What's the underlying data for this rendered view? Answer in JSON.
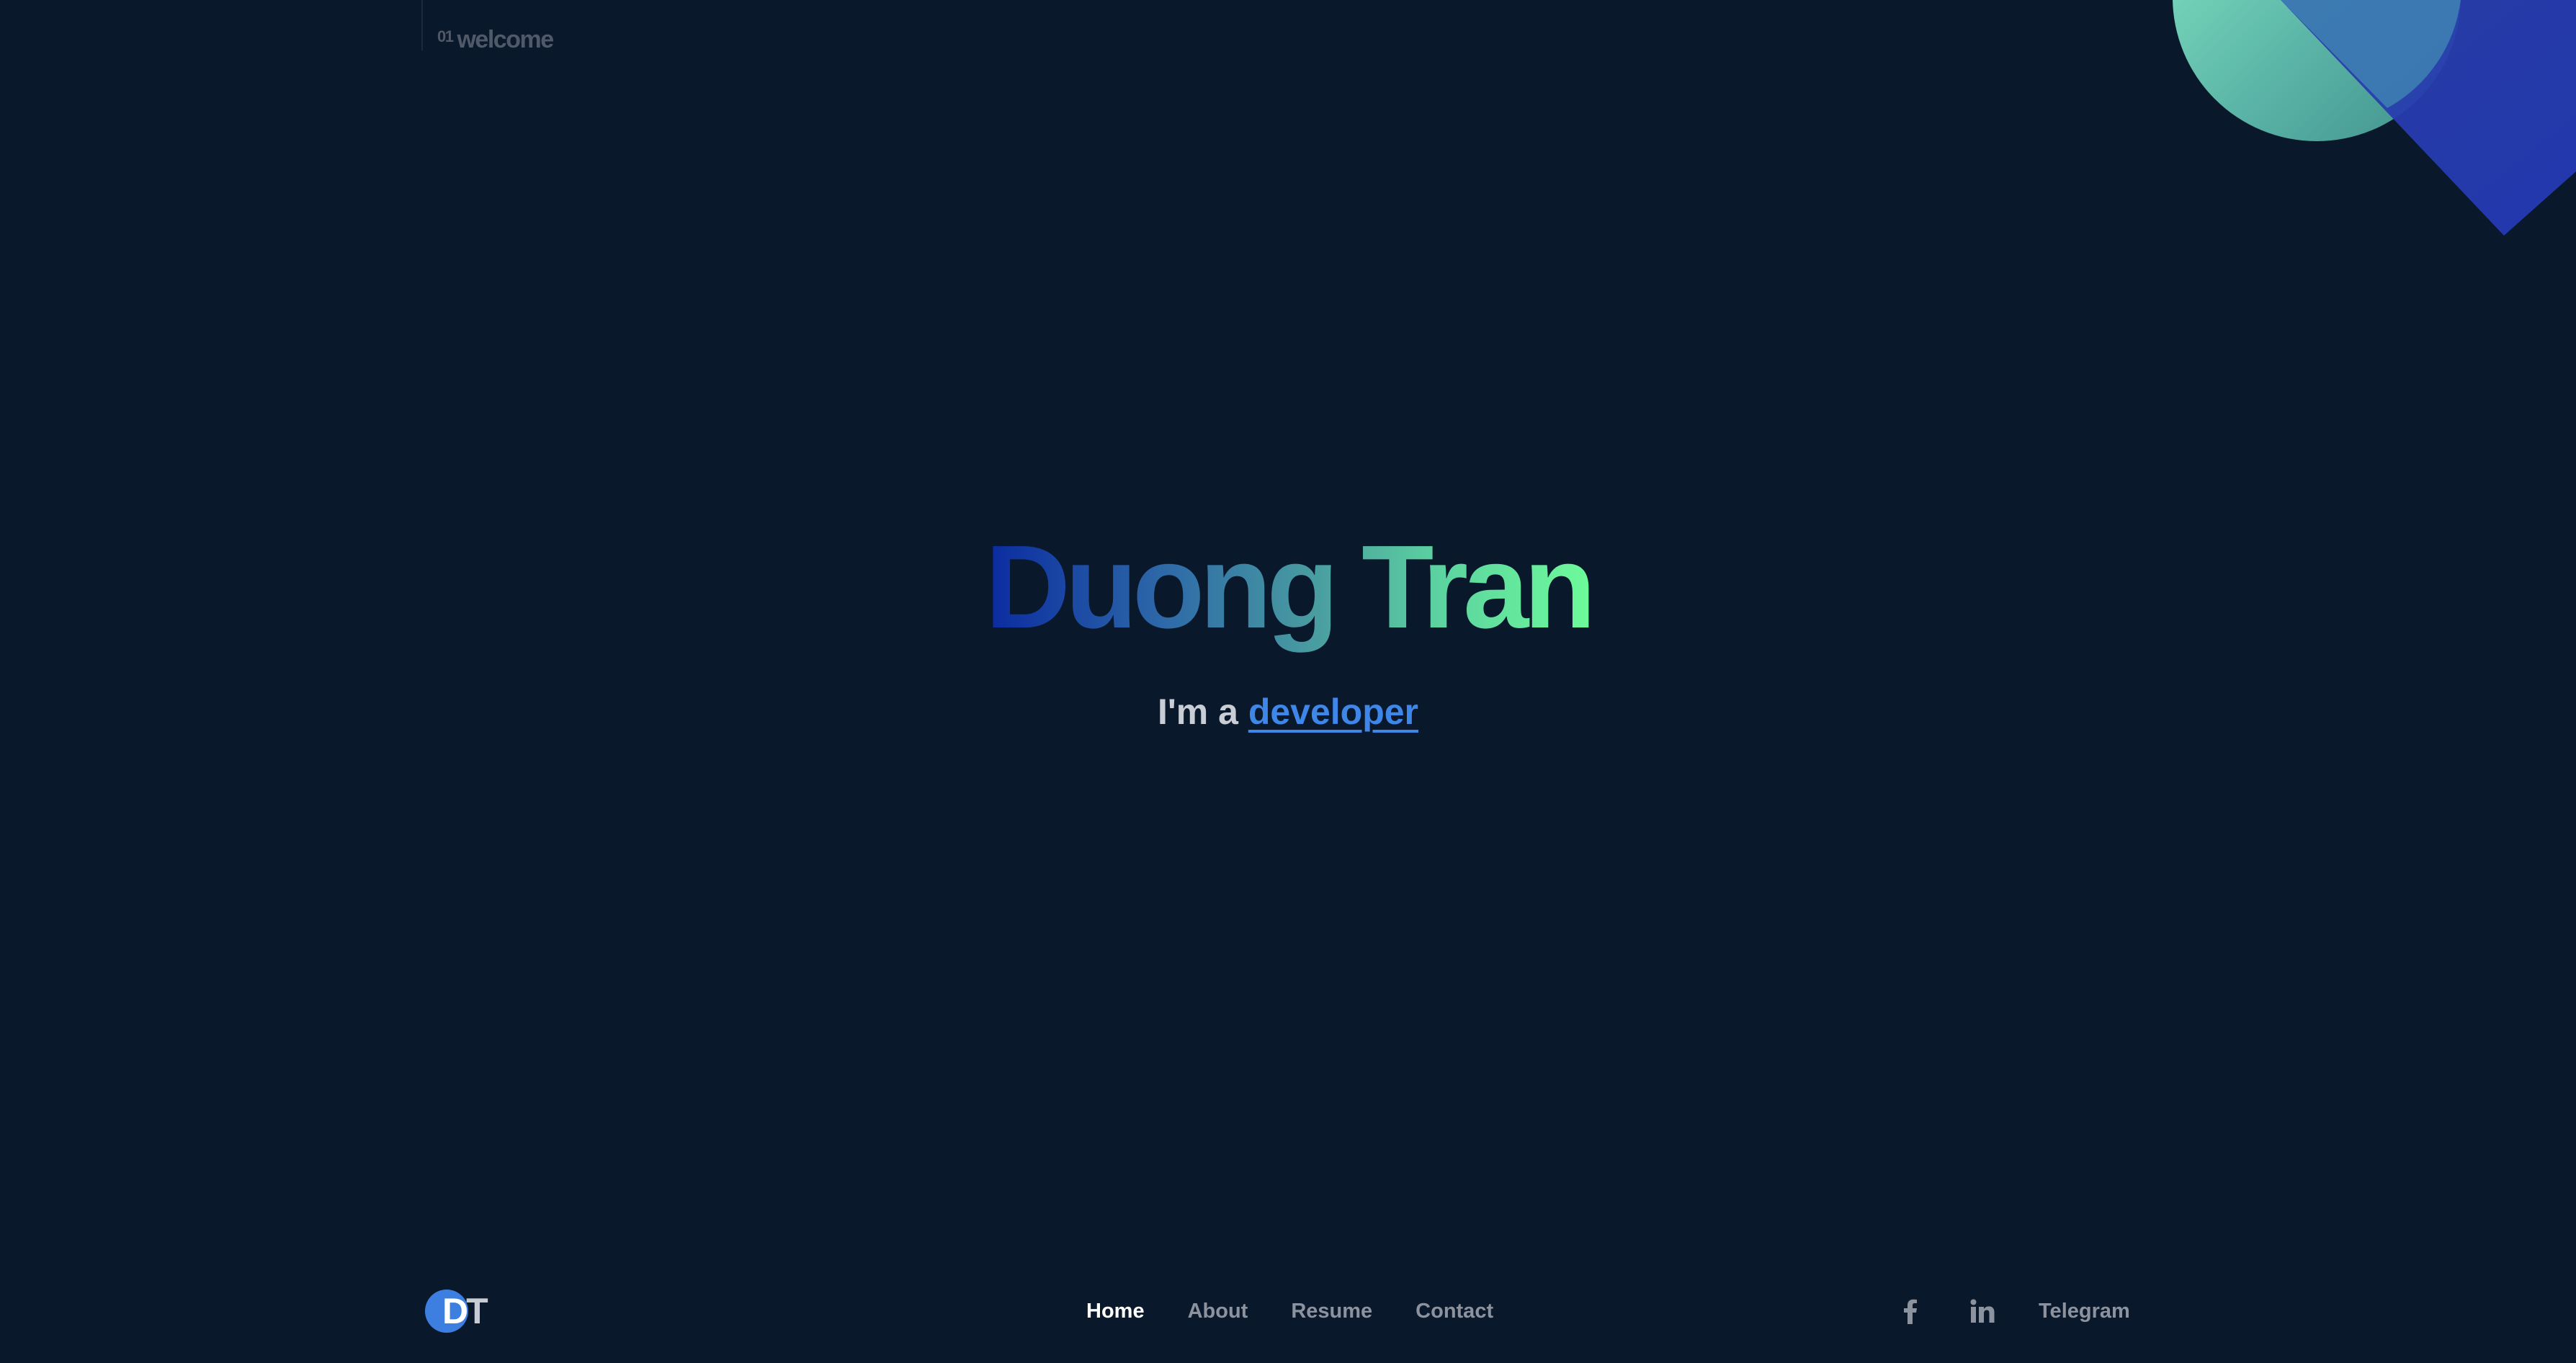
{
  "section": {
    "number": "01",
    "label": "welcome"
  },
  "hero": {
    "name": "Duong Tran",
    "intro": "I'm a",
    "role": "developer"
  },
  "footer": {
    "logo": {
      "first": "D",
      "second": "T"
    },
    "nav": [
      {
        "label": "Home",
        "active": true
      },
      {
        "label": "About",
        "active": false
      },
      {
        "label": "Resume",
        "active": false
      },
      {
        "label": "Contact",
        "active": false
      }
    ],
    "social": {
      "icons": [
        "facebook-icon",
        "linkedin-icon"
      ],
      "telegram_label": "Telegram"
    }
  },
  "colors": {
    "background": "#0a182b",
    "accent_blue": "#3e86e8",
    "gradient_start": "#0a2aa0",
    "gradient_end": "#6dfb9a",
    "nav_active": "#ffffff",
    "nav_inactive": "#8c939e"
  }
}
